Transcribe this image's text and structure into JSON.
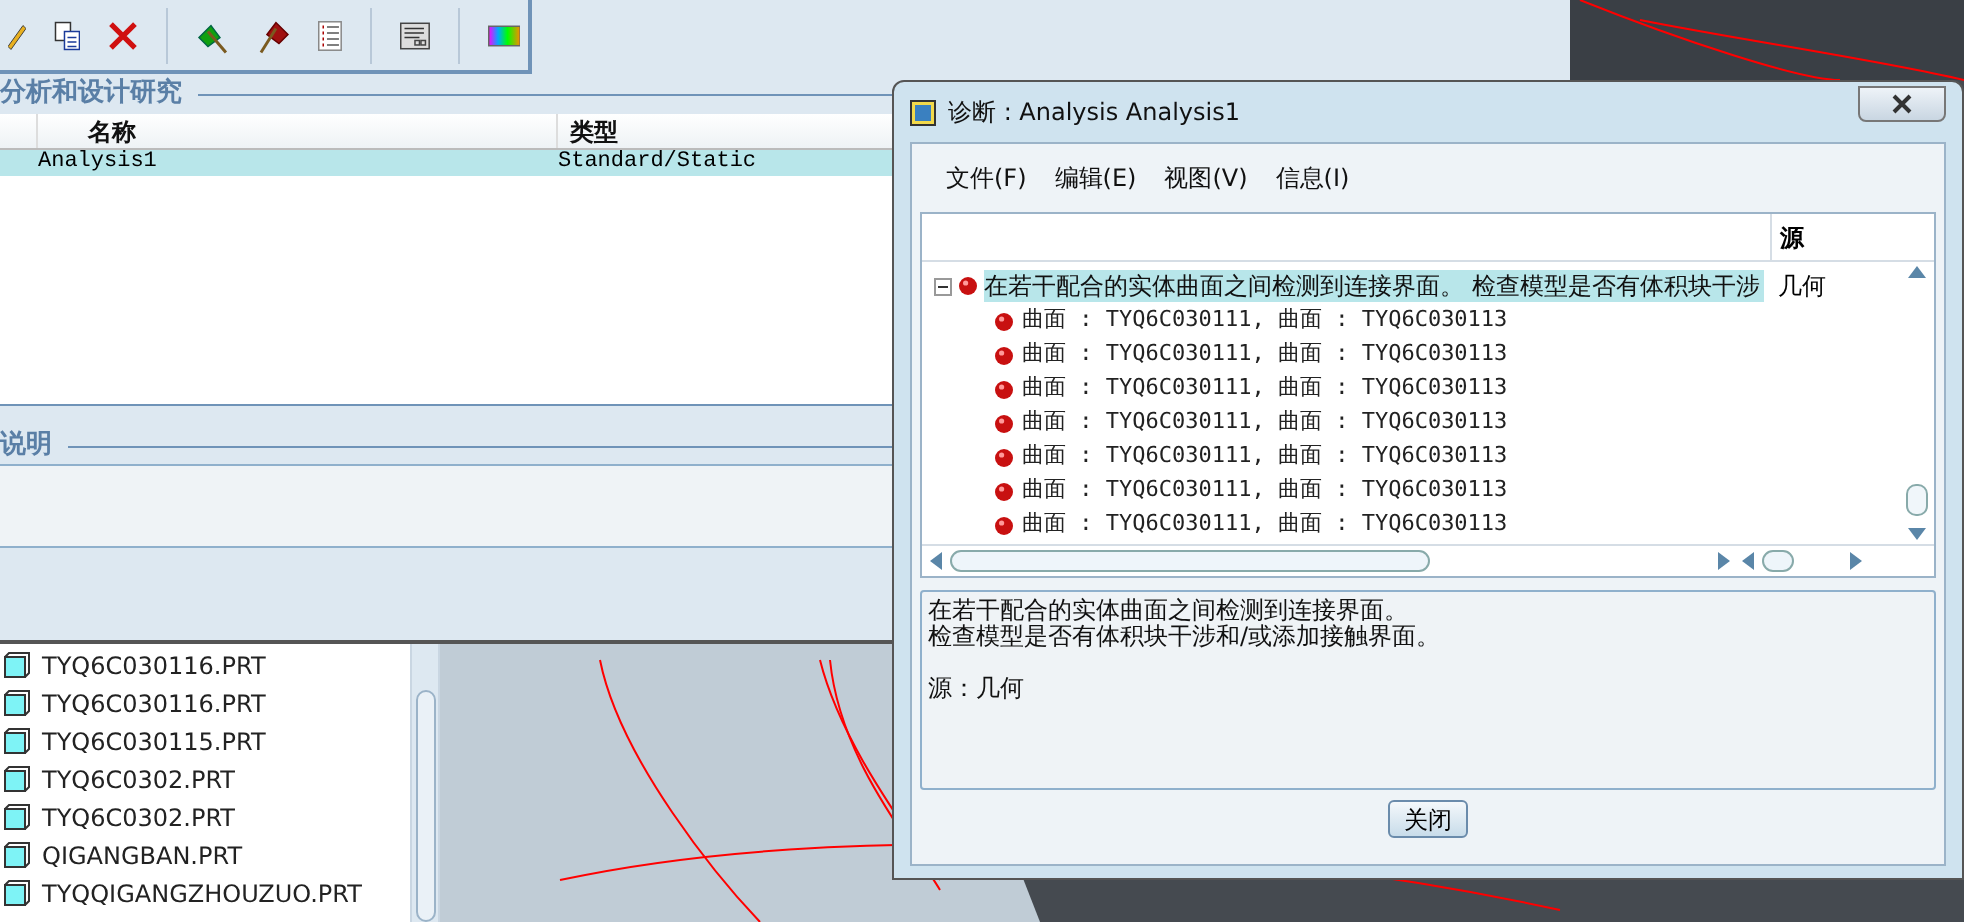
{
  "study_panel": {
    "title": "分析和设计研究",
    "columns": [
      "名称",
      "类型"
    ],
    "rows": [
      {
        "cells": [
          "Analysis1",
          "Standard/Static"
        ],
        "selected": true
      }
    ]
  },
  "description_panel": {
    "title": "说明"
  },
  "file_tree": {
    "items": [
      "TYQ6C030116.PRT",
      "TYQ6C030116.PRT",
      "TYQ6C030115.PRT",
      "TYQ6C0302.PRT",
      "TYQ6C0302.PRT",
      "QIGANGBAN.PRT",
      "TYQQIGANGZHOUZUO.PRT"
    ]
  },
  "dialog": {
    "title": "诊断 : Analysis Analysis1",
    "menu": [
      "文件(F)",
      "编辑(E)",
      "视图(V)",
      "信息(I)"
    ],
    "tree": {
      "columns": [
        "源"
      ],
      "items": [
        {
          "text": "在若干配合的实体曲面之间检测到连接界面。 检查模型是否有体积块干涉",
          "source": "几何",
          "expanded": true,
          "selected": true,
          "children": [
            {
              "text": "曲面 : TYQ6C030111, 曲面 : TYQ6C030113"
            },
            {
              "text": "曲面 : TYQ6C030111, 曲面 : TYQ6C030113"
            },
            {
              "text": "曲面 : TYQ6C030111, 曲面 : TYQ6C030113"
            },
            {
              "text": "曲面 : TYQ6C030111, 曲面 : TYQ6C030113"
            },
            {
              "text": "曲面 : TYQ6C030111, 曲面 : TYQ6C030113"
            },
            {
              "text": "曲面 : TYQ6C030111, 曲面 : TYQ6C030113"
            },
            {
              "text": "曲面 : TYQ6C030111, 曲面 : TYQ6C030113"
            }
          ]
        }
      ]
    },
    "details": {
      "lines": [
        "在若干配合的实体曲面之间检测到连接界面。",
        "检查模型是否有体积块干涉和/或添加接触界面。"
      ],
      "source": "源：几何"
    },
    "close_button": "关闭"
  }
}
